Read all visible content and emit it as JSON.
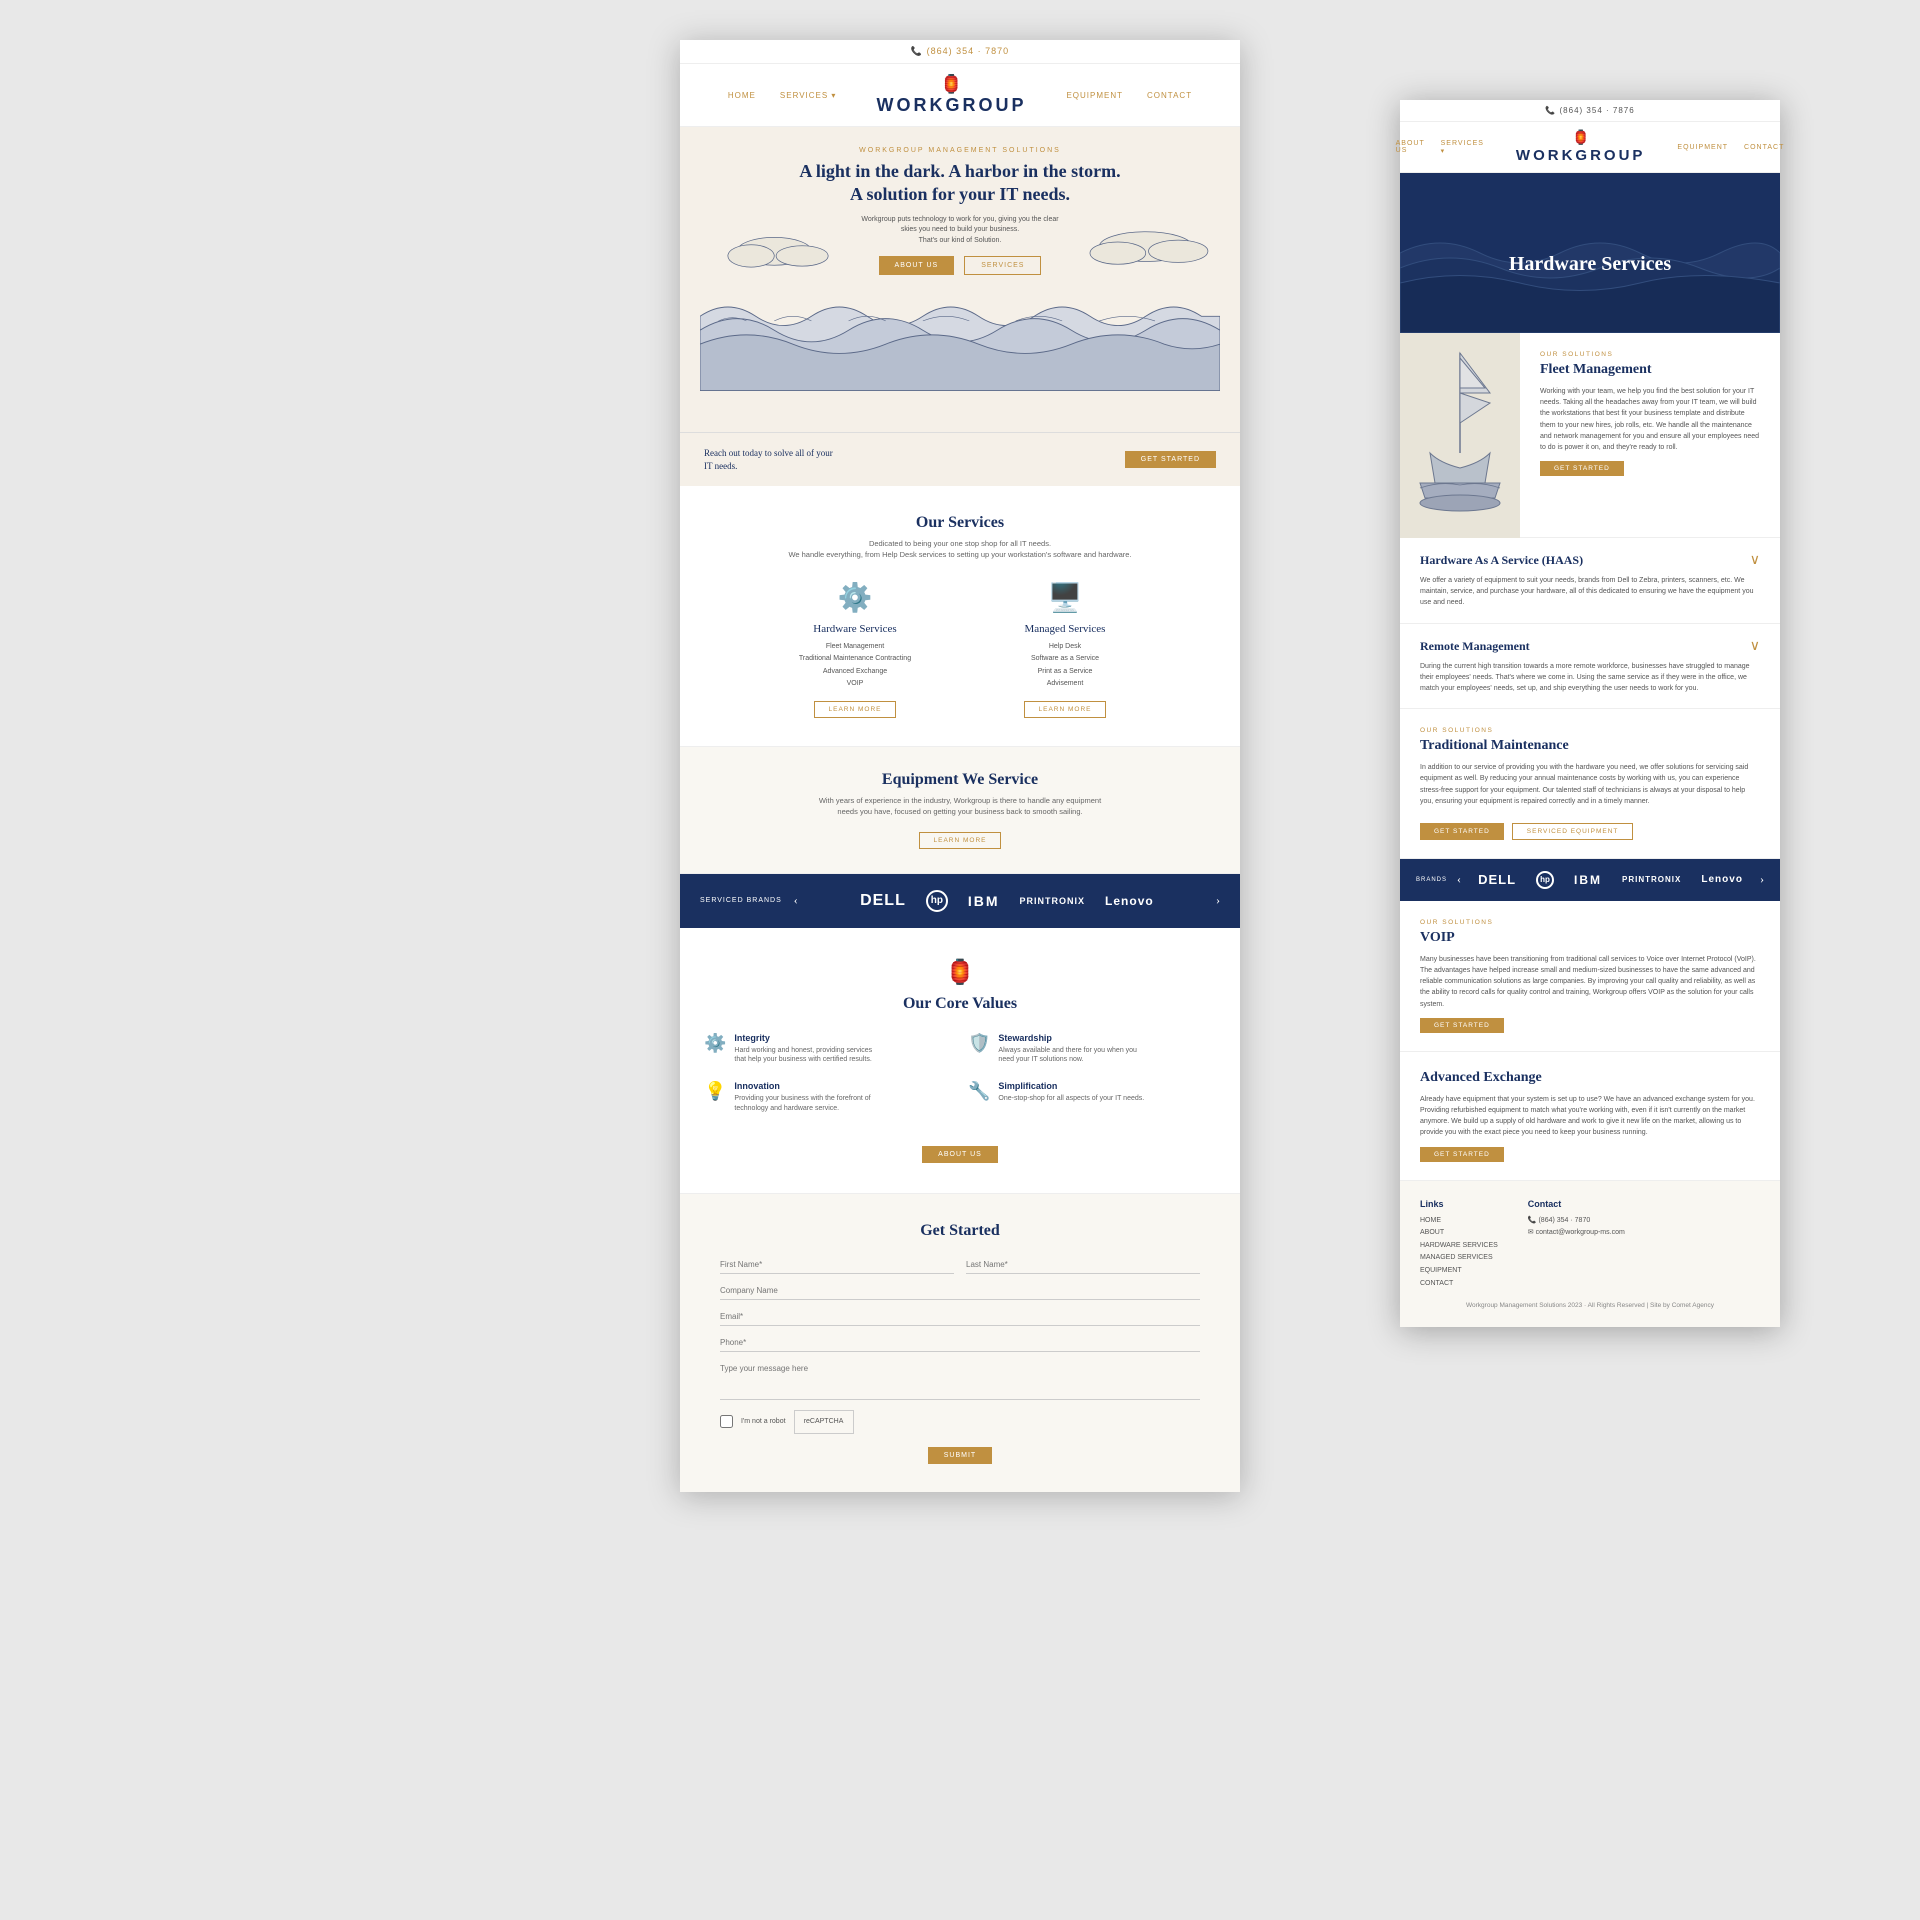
{
  "site": {
    "phone": "(864) 354 · 7870",
    "phone2": "(864) 354 · 7876",
    "company": "WORKGROUP",
    "tagline_small": "WORKGROUP MANAGEMENT SOLUTIONS",
    "hero_title": "A light in the dark. A harbor in the storm.\nA solution for your IT needs.",
    "hero_desc": "Workgroup puts technology to work for you, giving you the clear\nskies you need to build your business.\nThat's our kind of Solution.",
    "cta_text": "Reach out today to solve all of your\nIT needs.",
    "about_btn": "ABOUT US",
    "services_btn": "SERVICES",
    "get_started_btn": "GET STARTED",
    "services_title": "Our Services",
    "services_desc": "Dedicated to being your one stop shop for all IT needs.\nWe handle everything, from Help Desk services to setting up your workstation's software and hardware.",
    "hardware_title": "Hardware Services",
    "hardware_items": [
      "Fleet Management",
      "Traditional Maintenance Contracting",
      "Advanced Exchange",
      "VOIP"
    ],
    "managed_title": "Managed Services",
    "managed_items": [
      "Help Desk",
      "Software as a Service",
      "Print as a Service",
      "Advisement"
    ],
    "learn_more": "LEARN MORE",
    "equipment_title": "Equipment We Service",
    "equipment_desc": "With years of experience in the industry, Workgroup is there to handle any equipment\nneeds you have, focused on getting your business back to smooth sailing.",
    "brands_label": "SERVICED BRANDS",
    "brands": [
      "DELL",
      "hp",
      "IBM",
      "PRINTRONIX",
      "Lenovo"
    ],
    "core_values_title": "Our Core Values",
    "values": [
      {
        "title": "Integrity",
        "desc": "Hard working and honest, providing services\nthat help your business with certified results."
      },
      {
        "title": "Stewardship",
        "desc": "Always available and there for you when you\nneed your IT solutions now."
      },
      {
        "title": "Innovation",
        "desc": "Providing your business with the forefront of\ntechnology and hardware service."
      },
      {
        "title": "Simplification",
        "desc": "One-stop-shop for all aspects of your IT needs."
      }
    ],
    "about_us_btn": "ABOUT US",
    "form_title": "Get Started",
    "form_fields": {
      "first_name": "First Name*",
      "last_name": "Last Name*",
      "company": "Company Name",
      "email": "Email*",
      "phone": "Phone*",
      "message": "Type your message here",
      "submit": "SUBMIT"
    },
    "overlay": {
      "hero_title": "Hardware Services",
      "solutions_label": "OUR SOLUTIONS",
      "fleet_title": "Fleet Management",
      "fleet_body": "Working with your team, we help you find the best solution for your IT needs. Taking all the headaches away from your IT team, we will build the workstations that best fit your business template and distribute them to your new hires, job rolls, etc. We handle all the maintenance and network management for you and ensure all your employees need to do is power it on, and they're ready to roll.",
      "haas_title": "Hardware As A Service (HAAS)",
      "haas_body": "We offer a variety of equipment to suit your needs, brands from Dell to Zebra, printers, scanners, etc. We maintain, service, and purchase your hardware, all of this dedicated to ensuring we have the equipment you use and need.",
      "remote_title": "Remote Management",
      "remote_body": "During the current high transition towards a more remote workforce, businesses have struggled to manage their employees' needs. That's where we come in. Using the same service as if they were in the office, we match your employees' needs, set up, and ship everything the user needs to work for you.",
      "traditional_label": "OUR SOLUTIONS",
      "traditional_title": "Traditional Maintenance",
      "traditional_body": "In addition to our service of providing you with the hardware you need, we offer solutions for servicing said equipment as well. By reducing your annual maintenance costs by working with us, you can experience stress-free support for your equipment. Our talented staff of technicians is always at your disposal to help you, ensuring your equipment is repaired correctly and in a timely manner.",
      "voip_label": "OUR SOLUTIONS",
      "voip_title": "VOIP",
      "voip_body": "Many businesses have been transitioning from traditional call services to Voice over Internet Protocol (VoIP). The advantages have helped increase small and medium-sized businesses to have the same advanced and reliable communication solutions as large companies. By improving your call quality and reliability, as well as the ability to record calls for quality control and training, Workgroup offers VOIP as the solution for your calls system.",
      "exchange_title": "Advanced Exchange",
      "exchange_body": "Already have equipment that your system is set up to use? We have an advanced exchange system for you. Providing refurbished equipment to match what you're working with, even if it isn't currently on the market anymore. We build up a supply of old hardware and work to give it new life on the market, allowing us to provide you with the exact piece you need to keep your business running.",
      "get_started_btn": "GET STARTED",
      "serviced_equipment_btn": "SERVICED EQUIPMENT",
      "footer_links_title": "Links",
      "footer_links": [
        "HOME",
        "ABOUT",
        "HARDWARE SERVICES",
        "MANAGED SERVICES",
        "EQUIPMENT",
        "CONTACT"
      ],
      "footer_contact_title": "Contact",
      "footer_phone": "(864) 354 · 7870",
      "footer_email": "contact@workgroup-ms.com",
      "footer_copy": "Workgroup Management Solutions 2023 · All Rights Reserved | Site by Comet Agency"
    }
  }
}
